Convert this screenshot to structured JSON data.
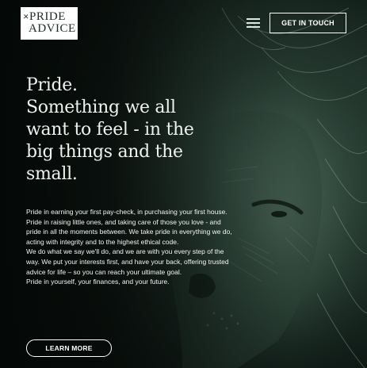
{
  "brand": {
    "logo_line1": "PRIDE",
    "logo_line2": "ADVICE",
    "logo_mark": "✕"
  },
  "header": {
    "menu_icon": "hamburger-icon",
    "cta_label": "GET IN TOUCH"
  },
  "hero": {
    "headline_lines": [
      "Pride.",
      "Something we all",
      "want to feel - in the",
      "big things and the",
      "small."
    ],
    "paragraphs": [
      "Pride in earning your first pay-check, in purchasing your first house. Pride in raising little ones, and taking care of those you love - and pride in all the moments between. We take pride in everything we do, acting with integrity and to the highest ethical code.",
      "We do what we say we'll do, and we are with you every step of the way. We put your interests first, and have your back, offering trusted advice for life – so you can reach your ultimate goal.",
      "Pride in yourself, your finances, and your future."
    ],
    "button_label": "LEARN MORE",
    "background_image": "lion-portrait"
  },
  "colors": {
    "background": "#0c1512",
    "accent_green": "#3f5b4f",
    "text": "#ffffff"
  }
}
